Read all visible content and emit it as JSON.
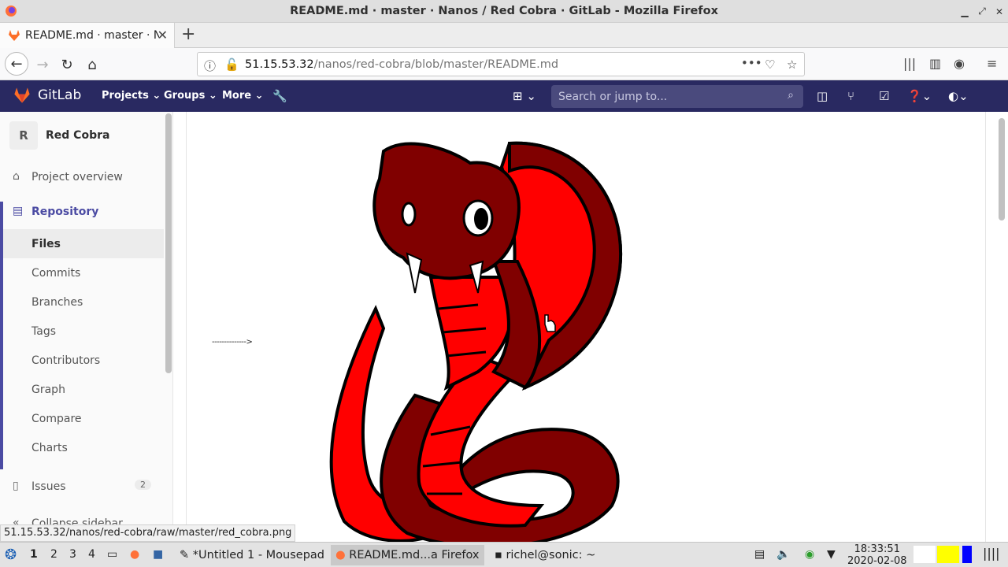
{
  "window": {
    "title": "README.md · master · Nanos / Red Cobra · GitLab - Mozilla Firefox"
  },
  "browser": {
    "tab_label": "README.md · master · N",
    "url_host": "51.15.53.32",
    "url_path": "/nanos/red-cobra/blob/master/README.md",
    "status_url": "51.15.53.32/nanos/red-cobra/raw/master/red_cobra.png"
  },
  "gitlab": {
    "brand": "GitLab",
    "nav": [
      "Projects",
      "Groups",
      "More"
    ],
    "search_placeholder": "Search or jump to...",
    "header_color": "#292961"
  },
  "sidebar": {
    "project_initial": "R",
    "project_name": "Red Cobra",
    "overview": "Project overview",
    "repository": "Repository",
    "repo_items": [
      "Files",
      "Commits",
      "Branches",
      "Tags",
      "Contributors",
      "Graph",
      "Compare",
      "Charts"
    ],
    "issues": "Issues",
    "issues_count": "2",
    "collapse": "Collapse sidebar"
  },
  "content": {
    "arrow_text": "-------------->",
    "image_colors": {
      "dark_red": "#800000",
      "bright_red": "#ff0000"
    }
  },
  "taskbar": {
    "workspaces": [
      "1",
      "2",
      "3",
      "4"
    ],
    "windows": [
      "*Untitled 1 - Mousepad",
      "README.md...a Firefox",
      "richel@sonic: ~"
    ],
    "time": "18:33:51",
    "date": "2020-02-08"
  }
}
